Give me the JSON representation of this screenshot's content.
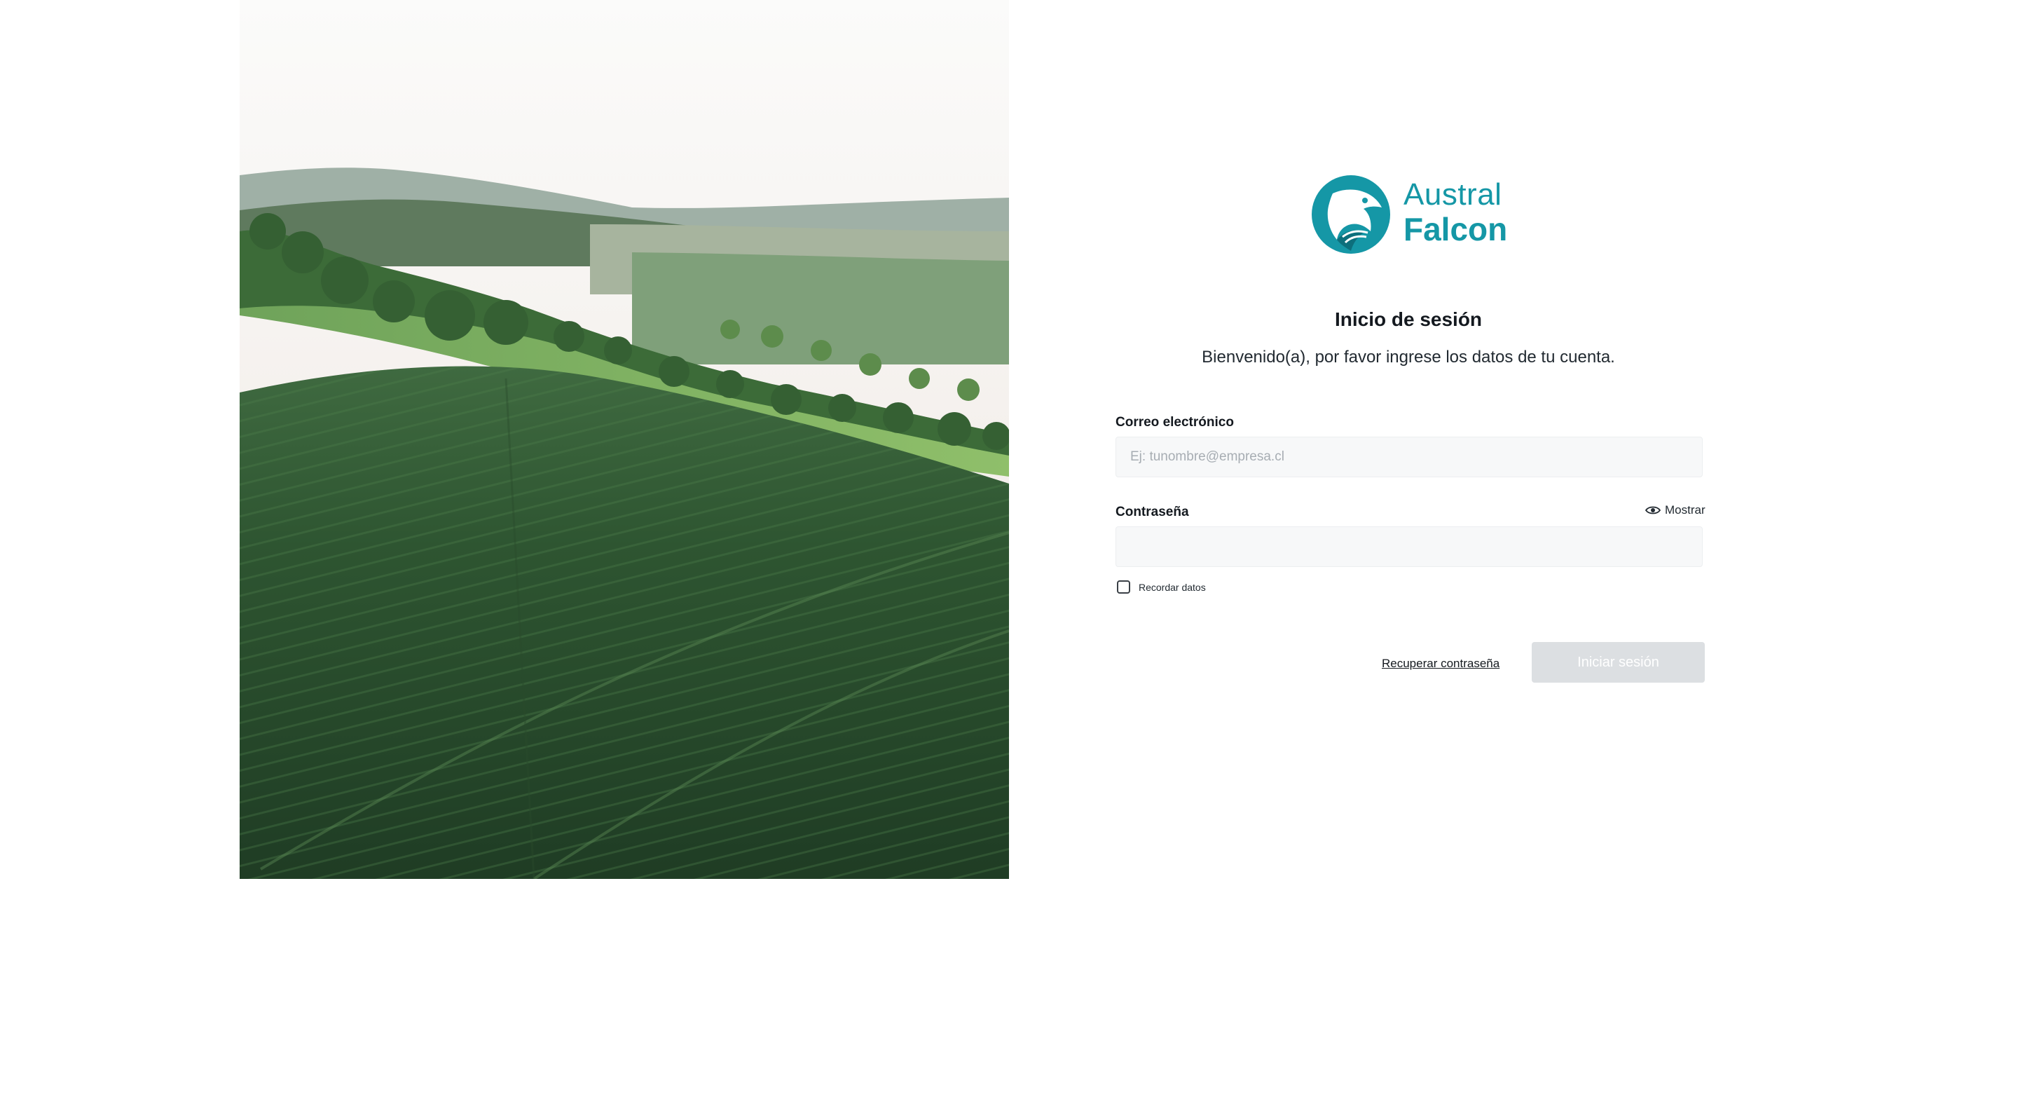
{
  "brand": {
    "name_line1": "Austral",
    "name_line2": "Falcon",
    "color": "#1597a6",
    "logo_icon": "falcon-head-icon"
  },
  "hero_image": {
    "alt": "green-field-landscape"
  },
  "login": {
    "title": "Inicio de sesión",
    "subtitle": "Bienvenido(a), por favor ingrese los datos de tu cuenta.",
    "email": {
      "label": "Correo electrónico",
      "placeholder": "Ej: tunombre@empresa.cl",
      "value": ""
    },
    "password": {
      "label": "Contraseña",
      "value": "",
      "show_label": "Mostrar",
      "show_icon": "eye-icon"
    },
    "remember": {
      "label": "Recordar datos",
      "checked": false
    },
    "recover_link": "Recuperar contraseña",
    "submit_label": "Iniciar sesión",
    "submit_disabled": true
  }
}
